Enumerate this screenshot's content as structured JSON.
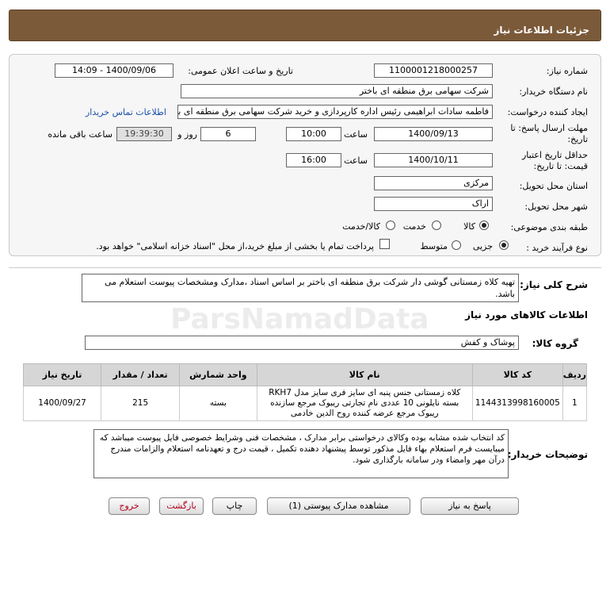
{
  "header": {
    "title": "جزئيات اطلاعات نياز"
  },
  "fields": {
    "need_number": {
      "label": "شماره نیاز:",
      "value": "1100001218000257"
    },
    "announce_datetime": {
      "label": "تاریخ و ساعت اعلان عمومی:",
      "value": "1400/09/06 - 14:09"
    },
    "buyer_org": {
      "label": "نام دستگاه خریدار:",
      "value": "شرکت سهامی برق منطقه ای باختر"
    },
    "requester": {
      "label": "ایجاد کننده درخواست:",
      "value": "فاطمه سادات ابراهیمی رئیس اداره کارپردازی و خرید شرکت سهامی برق منطقه ای باختر",
      "contact_link": "اطلاعات تماس خریدار"
    },
    "reply_deadline": {
      "label_line1": "مهلت ارسال پاسخ: تا",
      "label_line2": "تاریخ:",
      "date": "1400/09/13",
      "time_label": "ساعت",
      "time": "10:00",
      "days": "6",
      "days_label": "روز و",
      "remaining": "19:39:30",
      "remaining_label": "ساعت باقی مانده"
    },
    "price_validity": {
      "label_line1": "حداقل تاریخ اعتبار",
      "label_line2": "قیمت: تا تاریخ:",
      "date": "1400/10/11",
      "time_label": "ساعت",
      "time": "16:00"
    },
    "delivery_province": {
      "label": "استان محل تحویل:",
      "value": "مرکزی"
    },
    "delivery_city": {
      "label": "شهر محل تحویل:",
      "value": "اراک"
    },
    "category": {
      "label": "طبقه بندی موضوعی:",
      "options": [
        "کالا",
        "خدمت",
        "کالا/خدمت"
      ],
      "selected": "کالا"
    },
    "purchase_type": {
      "label": "نوع فرآیند خرید :",
      "options": [
        "جزیی",
        "متوسط"
      ],
      "selected": "جزیی",
      "treasury_note": "پرداخت تمام یا بخشی از مبلغ خرید،از محل \"اسناد خزانه اسلامی\" خواهد بود."
    }
  },
  "summary": {
    "label": "شرح کلی نیاز:",
    "text": "تهیه کلاه زمستانی گوشی دار شرکت برق منطقه ای باختر بر اساس اسناد ،مدارک ومشخصات پیوست استعلام می باشد."
  },
  "goods_section": {
    "title": "اطلاعات کالاهای مورد نیاز"
  },
  "goods_group": {
    "label": "گروه کالا:",
    "value": "پوشاک و کفش"
  },
  "table": {
    "headers": [
      "ردیف",
      "کد کالا",
      "نام کالا",
      "واحد شمارش",
      "تعداد / مقدار",
      "تاریخ نیاز"
    ],
    "rows": [
      {
        "row": "1",
        "code": "1144313998160005",
        "name": "کلاه زمستانی جنس پنبه ای سایز فری سایز مدل RKH7 بسته نایلونی 10 عددی نام تجارتی ریبوک مرجع سازنده ریبوک مرجع عرضه کننده روح الدین خادمی",
        "unit": "بسته",
        "qty": "215",
        "date": "1400/09/27"
      }
    ]
  },
  "buyer_notes": {
    "label": "توضیحات خریدار:",
    "text": "کد انتخاب شده مشابه بوده وکالای درخواستی برابر مدارک ، مشخصات فنی وشرایط خصوصی فایل پیوست میباشد که میبایست فرم استعلام بهاء فایل مذکور توسط پیشنهاد دهنده تکمیل ، قیمت درج و تعهدنامه استعلام والزامات  مندرج درآن مهر وامضاء ودر سامانه بارگذاری شود."
  },
  "buttons": {
    "reply": "پاسخ به نیاز",
    "attachments": "مشاهده مدارک پیوستی (1)",
    "print": "چاپ",
    "back": "بازگشت",
    "exit": "خروج"
  },
  "watermark": {
    "brand": "ParsNamadData"
  },
  "colors": {
    "header_bg": "#7b5a3a",
    "link": "#1a4fa8",
    "danger": "#b00020"
  }
}
